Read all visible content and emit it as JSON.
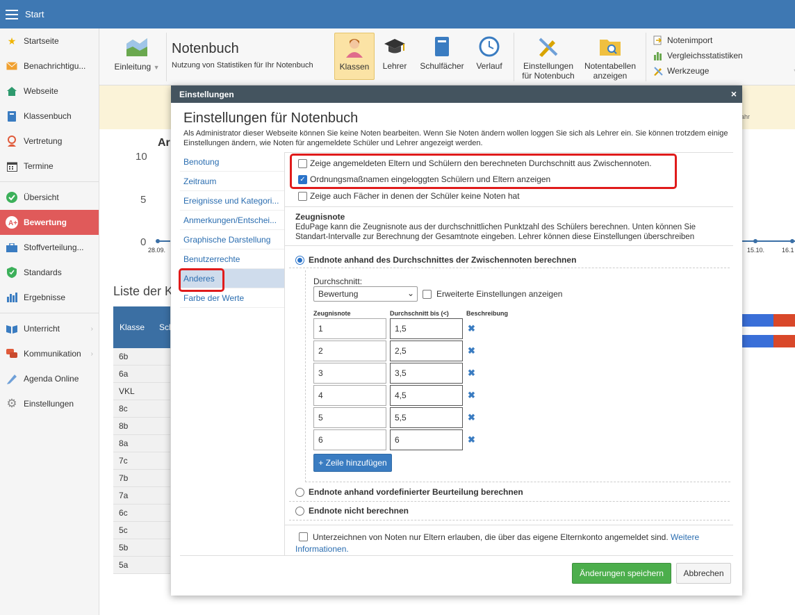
{
  "topbar": {
    "title": "Start"
  },
  "sidebar": {
    "items": [
      {
        "label": "Startseite",
        "icon": "star-icon"
      },
      {
        "label": "Benachrichtigu...",
        "icon": "envelope-icon"
      },
      {
        "label": "Webseite",
        "icon": "home-icon"
      },
      {
        "label": "Klassenbuch",
        "icon": "book-icon"
      },
      {
        "label": "Vertretung",
        "icon": "person-icon"
      },
      {
        "label": "Termine",
        "icon": "calendar-icon"
      },
      {
        "label": "Übersicht",
        "icon": "check-circle-icon"
      },
      {
        "label": "Bewertung",
        "icon": "grade-icon"
      },
      {
        "label": "Stoffverteilung...",
        "icon": "briefcase-icon"
      },
      {
        "label": "Standards",
        "icon": "shield-icon"
      },
      {
        "label": "Ergebnisse",
        "icon": "bar-chart-icon"
      },
      {
        "label": "Unterricht",
        "icon": "book-open-icon"
      },
      {
        "label": "Kommunikation",
        "icon": "chat-icon"
      },
      {
        "label": "Agenda Online",
        "icon": "pen-icon"
      },
      {
        "label": "Einstellungen",
        "icon": "gear-icon"
      }
    ]
  },
  "toolbar": {
    "intro_label": "Einleitung",
    "title": "Notenbuch",
    "subtitle": "Nutzung von Statistiken für Ihr Notenbuch",
    "klassen": "Klassen",
    "lehrer": "Lehrer",
    "schulfaecher": "Schulfächer",
    "verlauf": "Verlauf",
    "einstellungen_l1": "Einstellungen",
    "einstellungen_l2": "für Notenbuch",
    "notentabellen_l1": "Notentabellen",
    "notentabellen_l2": "anzeigen",
    "notenimport": "Notenimport",
    "vergleich": "Vergleichsstatistiken",
    "werkzeuge": "Werkzeuge"
  },
  "background": {
    "chart_heading": "Ar",
    "y_labels": [
      "10",
      "5",
      "0"
    ],
    "dates": [
      "28.09.",
      "15.10.",
      "16.1"
    ],
    "right_fragment": "jahr",
    "list_title": "Liste der K",
    "table_header": "Klasse",
    "table_header2": "Sch",
    "classes": [
      "6b",
      "6a",
      "VKL",
      "8c",
      "8b",
      "8a",
      "7c",
      "7b",
      "7a",
      "6c",
      "5c",
      "5b",
      "5a"
    ]
  },
  "modal": {
    "header": "Einstellungen",
    "close": "×",
    "title": "Einstellungen für Notenbuch",
    "desc": "Als Administrator dieser Webseite können Sie keine Noten bearbeiten. Wenn Sie Noten ändern wollen loggen Sie sich als Lehrer ein. Sie können trotzdem einige Einstellungen ändern, wie Noten für angemeldete Schüler und Lehrer angezeigt werden.",
    "nav": [
      "Benotung",
      "Zeitraum",
      "Ereignisse und Kategori...",
      "Anmerkungen/Entschei...",
      "Graphische Darstellung",
      "Benutzerrechte",
      "Anderes",
      "Farbe der Werte"
    ],
    "chk1": "Zeige angemeldeten Eltern und Schülern den berechneten Durchschnitt aus Zwischennoten.",
    "chk2": "Ordnungsmaßnamen eingeloggten Schülern und Eltern anzeigen",
    "chk3": "Zeige auch Fächer in denen der Schüler keine Noten hat",
    "zeugnis_title": "Zeugnisnote",
    "zeugnis_desc": "EduPage kann die Zeugnisnote aus der durchschnittlichen Punktzahl des Schülers berechnen. Unten können Sie Standart-Intervalle zur Berechnung der Gesamtnote eingeben. Lehrer können diese Einstellungen überschreiben",
    "radio1": "Endnote anhand des Durchschnittes der Zwischennoten berechnen",
    "durchschnitt_label": "Durchschnitt:",
    "select_value": "Bewertung",
    "erweiterte": "Erweiterte Einstellungen anzeigen",
    "col_zeugnis": "Zeugnisnote",
    "col_durch": "Durchschnitt bis (<)",
    "col_besch": "Beschreibung",
    "rows": [
      {
        "note": "1",
        "bis": "1,5"
      },
      {
        "note": "2",
        "bis": "2,5"
      },
      {
        "note": "3",
        "bis": "3,5"
      },
      {
        "note": "4",
        "bis": "4,5"
      },
      {
        "note": "5",
        "bis": "5,5"
      },
      {
        "note": "6",
        "bis": "6"
      }
    ],
    "add_row": "+ Zeile hinzufügen",
    "radio2": "Endnote anhand vordefinierter Beurteilung berechnen",
    "radio3": "Endnote nicht berechnen",
    "sign_text": "Unterzeichnen von Noten nur Eltern erlauben, die über das eigene Elternkonto angemeldet sind.",
    "sign_link1": "Weitere",
    "sign_link2": "Informationen.",
    "save": "Änderungen speichern",
    "cancel": "Abbrechen"
  }
}
